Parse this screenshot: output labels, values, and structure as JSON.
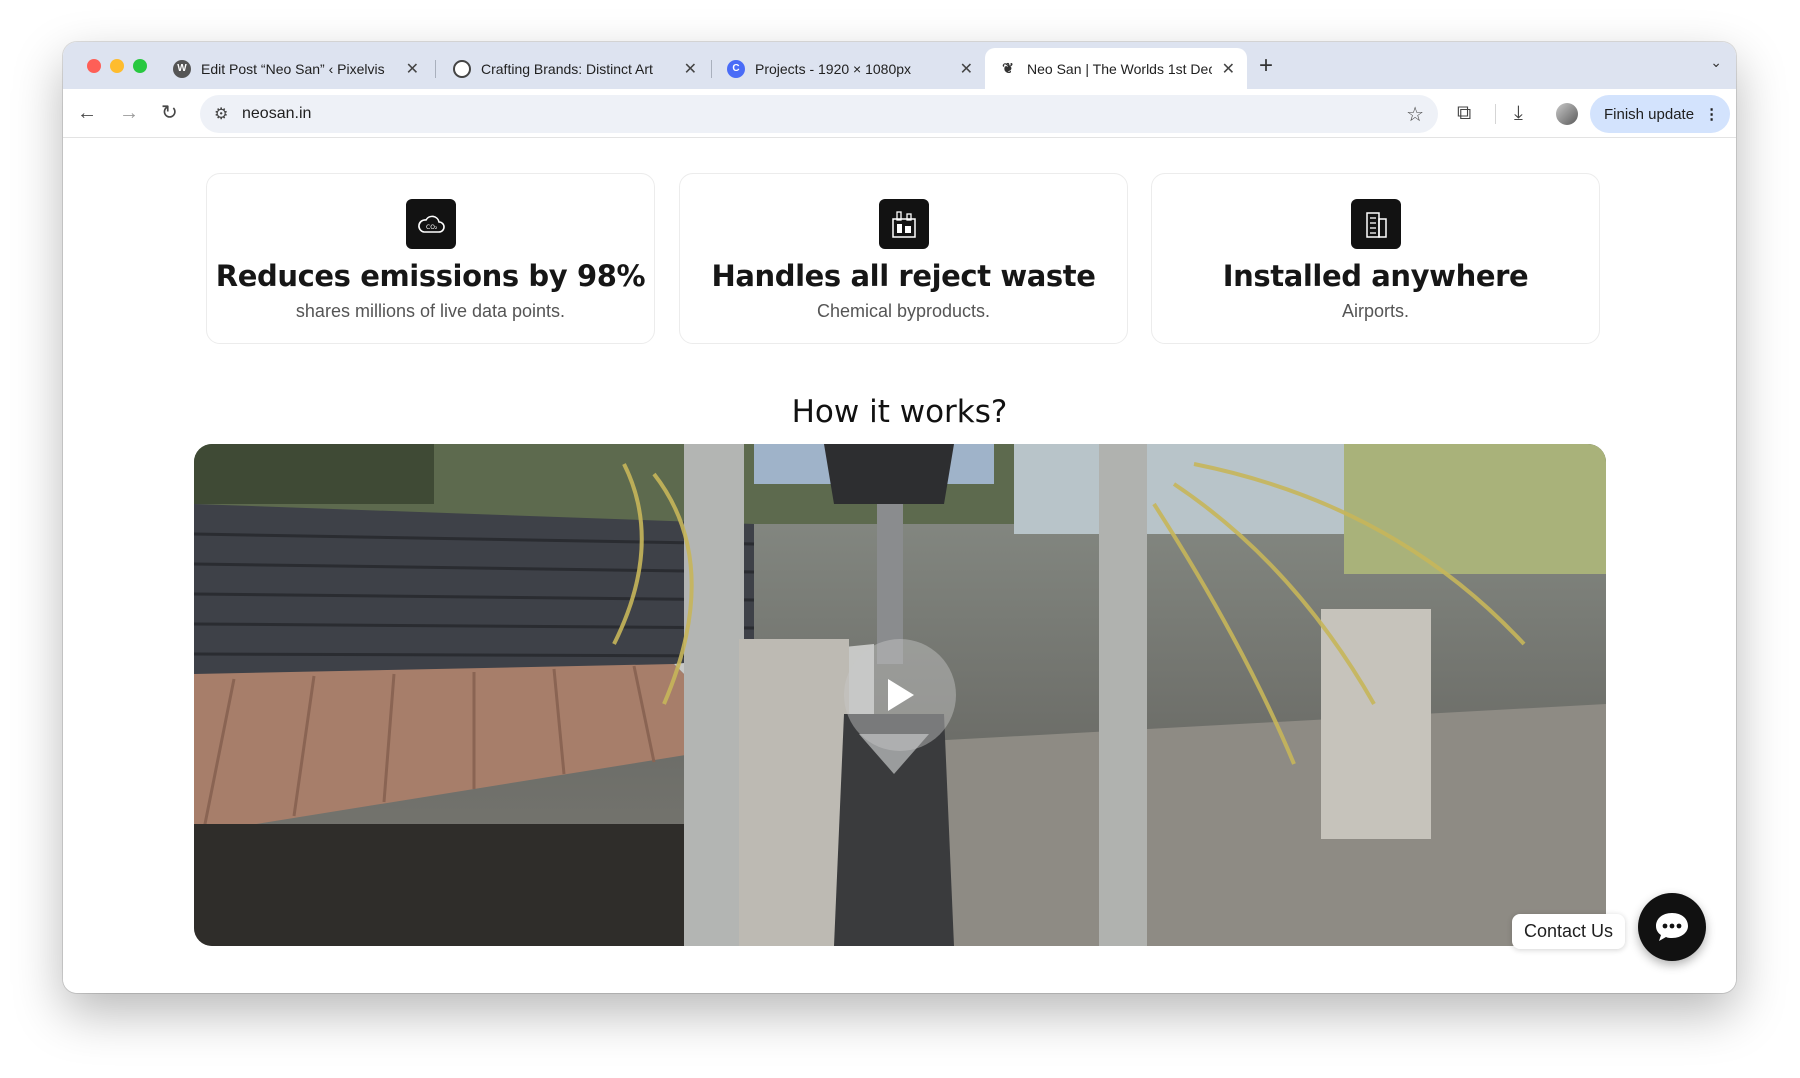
{
  "browser": {
    "tabs": [
      {
        "title": "Edit Post “Neo San” ‹ Pixelvis",
        "favicon": "wordpress-icon"
      },
      {
        "title": "Crafting Brands: Distinct Art",
        "favicon": "openai-icon"
      },
      {
        "title": "Projects - 1920 × 1080px",
        "favicon": "canva-icon"
      },
      {
        "title": "Neo San | The Worlds 1st Dec",
        "favicon": "neosan-icon",
        "active": true
      }
    ],
    "url": "neosan.in",
    "finish_update_label": "Finish update"
  },
  "features": [
    {
      "icon": "cloud-co2-icon",
      "heading": "Reduces emissions by 98%",
      "subtext": "shares millions of live data points."
    },
    {
      "icon": "chemical-bottles-icon",
      "heading": "Handles all reject waste",
      "subtext": "Chemical byproducts."
    },
    {
      "icon": "building-icon",
      "heading": "Installed anywhere",
      "subtext": "Airports."
    }
  ],
  "how_it_works": {
    "title": "How it works?"
  },
  "contact": {
    "label": "Contact Us"
  },
  "colors": {
    "accent_dark": "#121212",
    "tabstrip": "#dde3f0",
    "finish_button": "#d3e3fd"
  }
}
